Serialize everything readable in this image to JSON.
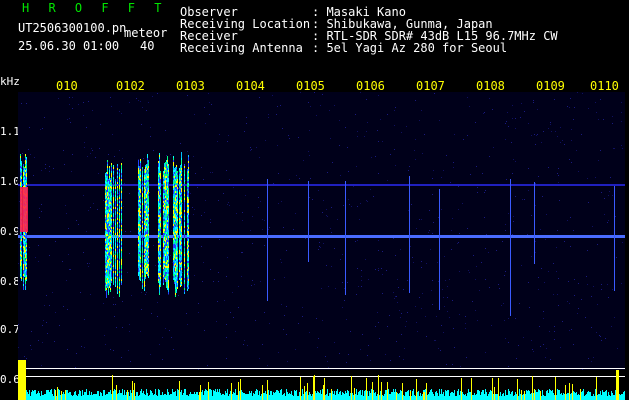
{
  "header": {
    "app_title": "H R O F F T",
    "filename": "UT2506300100.pn",
    "meteor_label": "meteor",
    "datetime": "25.06.30 01:00",
    "meteor_count": "40"
  },
  "info": {
    "observer_label": "Observer",
    "observer_value": ": Masaki Kano",
    "location_label": "Receiving Location",
    "location_value": ": Shibukawa, Gunma, Japan",
    "receiver_label": "Receiver",
    "receiver_value": ": RTL-SDR SDR# 43dB L15 96.7MHz CW",
    "antenna_label": "Receiving Antenna",
    "antenna_value": ": 5el Yagi Az 280 for Seoul"
  },
  "axis": {
    "unit": "kHz",
    "y_ticks": [
      "1.1",
      "1.0",
      "0.9",
      "0.8",
      "0.7",
      "0.6"
    ],
    "x_ticks": [
      "010",
      "0102",
      "0103",
      "0104",
      "0105",
      "0106",
      "0107",
      "0108",
      "0109",
      "0110"
    ]
  },
  "colors": {
    "background": "#000000",
    "plot_bg": "#00001a",
    "header_green": "#00e600",
    "tick_yellow": "#ffff00",
    "meter_cyan": "#00ffff"
  }
}
